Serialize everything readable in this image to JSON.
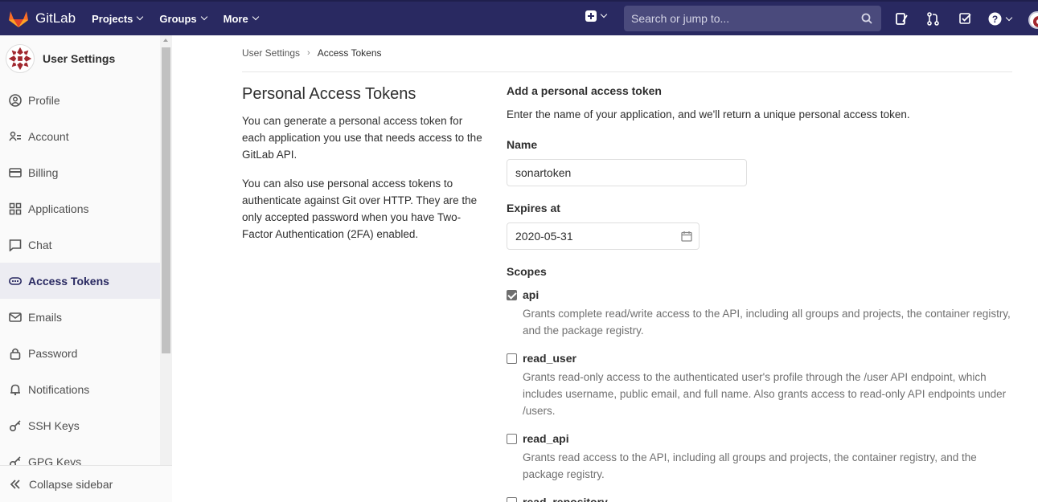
{
  "navbar": {
    "brand": "GitLab",
    "menu": [
      "Projects",
      "Groups",
      "More"
    ],
    "search_placeholder": "Search or jump to..."
  },
  "sidebar": {
    "title": "User Settings",
    "items": [
      {
        "label": "Profile",
        "icon": "profile-icon"
      },
      {
        "label": "Account",
        "icon": "account-icon"
      },
      {
        "label": "Billing",
        "icon": "billing-icon"
      },
      {
        "label": "Applications",
        "icon": "applications-icon"
      },
      {
        "label": "Chat",
        "icon": "chat-icon"
      },
      {
        "label": "Access Tokens",
        "icon": "token-icon",
        "active": true
      },
      {
        "label": "Emails",
        "icon": "email-icon"
      },
      {
        "label": "Password",
        "icon": "lock-icon"
      },
      {
        "label": "Notifications",
        "icon": "bell-icon"
      },
      {
        "label": "SSH Keys",
        "icon": "key-icon"
      },
      {
        "label": "GPG Keys",
        "icon": "key-icon"
      }
    ],
    "collapse_label": "Collapse sidebar"
  },
  "breadcrumb": {
    "parent": "User Settings",
    "current": "Access Tokens"
  },
  "intro": {
    "title": "Personal Access Tokens",
    "paragraphs": [
      "You can generate a personal access token for each application you use that needs access to the GitLab API.",
      "You can also use personal access tokens to authenticate against Git over HTTP. They are the only accepted password when you have Two-Factor Authentication (2FA) enabled."
    ]
  },
  "form": {
    "heading": "Add a personal access token",
    "description": "Enter the name of your application, and we'll return a unique personal access token.",
    "name_label": "Name",
    "name_value": "sonartoken",
    "expires_label": "Expires at",
    "expires_value": "2020-05-31",
    "scopes_label": "Scopes",
    "scopes": [
      {
        "name": "api",
        "checked": true,
        "help": "Grants complete read/write access to the API, including all groups and projects, the container registry, and the package registry."
      },
      {
        "name": "read_user",
        "checked": false,
        "help": "Grants read-only access to the authenticated user's profile through the /user API endpoint, which includes username, public email, and full name. Also grants access to read-only API endpoints under /users."
      },
      {
        "name": "read_api",
        "checked": false,
        "help": "Grants read access to the API, including all groups and projects, the container registry, and the package registry."
      },
      {
        "name": "read_repository",
        "checked": false,
        "help": ""
      }
    ]
  },
  "colors": {
    "navbar": "#292961",
    "sidebar_active": "#ececf2",
    "logo_orange": "#fc6d26"
  }
}
